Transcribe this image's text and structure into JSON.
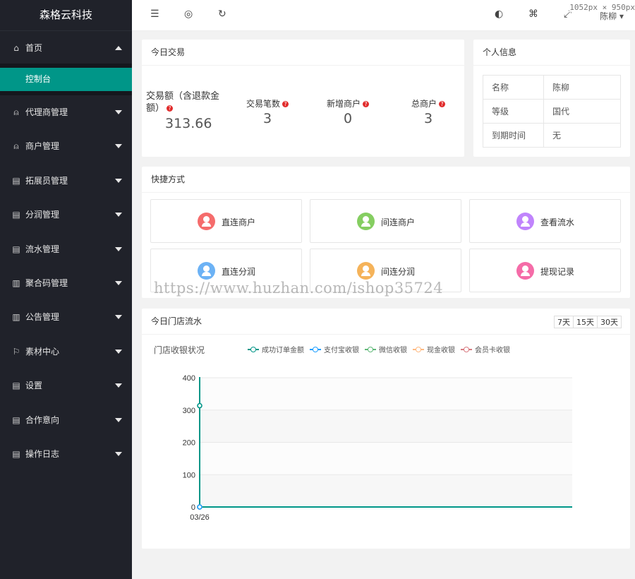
{
  "brand": "森格云科技",
  "sidebar": {
    "home": "首页",
    "active_sub": "控制台",
    "items": [
      {
        "label": "代理商管理",
        "icon": "user-icon"
      },
      {
        "label": "商户管理",
        "icon": "user-icon"
      },
      {
        "label": "拓展员管理",
        "icon": "document-icon"
      },
      {
        "label": "分润管理",
        "icon": "document-icon"
      },
      {
        "label": "流水管理",
        "icon": "document-icon"
      },
      {
        "label": "聚合码管理",
        "icon": "table-icon"
      },
      {
        "label": "公告管理",
        "icon": "table-icon"
      },
      {
        "label": "素材中心",
        "icon": "flag-icon"
      },
      {
        "label": "设置",
        "icon": "document-icon"
      },
      {
        "label": "合作意向",
        "icon": "document-icon"
      },
      {
        "label": "操作日志",
        "icon": "document-icon"
      }
    ]
  },
  "header": {
    "user": "陈柳",
    "size_badge": "1052px × 950px",
    "icons": [
      "menu-fold-icon",
      "globe-icon",
      "refresh-icon",
      "theme-icon",
      "tag-icon",
      "fullscreen-icon"
    ]
  },
  "today_trade": {
    "title": "今日交易",
    "stats": [
      {
        "label": "交易额（含退款金额）",
        "value": "313.66"
      },
      {
        "label": "交易笔数",
        "value": "3"
      },
      {
        "label": "新增商户",
        "value": "0"
      },
      {
        "label": "总商户",
        "value": "3"
      }
    ]
  },
  "personal": {
    "title": "个人信息",
    "rows": [
      {
        "k": "名称",
        "v": "陈柳"
      },
      {
        "k": "等级",
        "v": "国代"
      },
      {
        "k": "到期时间",
        "v": "无"
      }
    ]
  },
  "shortcuts": {
    "title": "快捷方式",
    "items": [
      {
        "label": "直连商户",
        "color": "#f56c6c"
      },
      {
        "label": "间连商户",
        "color": "#85ce61"
      },
      {
        "label": "查看流水",
        "color": "#c084fc"
      },
      {
        "label": "直连分润",
        "color": "#6cb2f5"
      },
      {
        "label": "间连分润",
        "color": "#f5b35a"
      },
      {
        "label": "提现记录",
        "color": "#f56ca8"
      }
    ]
  },
  "watermark": "https://www.huzhan.com/ishop35724",
  "flow": {
    "title": "今日门店流水",
    "ranges": [
      "7天",
      "15天",
      "30天"
    ],
    "subtitle": "门店收银状况"
  },
  "chart_data": {
    "type": "line",
    "categories": [
      "03/26"
    ],
    "ylim": [
      0,
      400
    ],
    "yticks": [
      0,
      100,
      200,
      300,
      400
    ],
    "series": [
      {
        "name": "成功订单金额",
        "color": "#009688",
        "values": [
          313.66
        ]
      },
      {
        "name": "支付宝收银",
        "color": "#1e9fff",
        "values": [
          0
        ]
      },
      {
        "name": "微信收银",
        "color": "#5fb878",
        "values": [
          0
        ]
      },
      {
        "name": "现金收银",
        "color": "#ffb980",
        "values": [
          0
        ]
      },
      {
        "name": "会员卡收银",
        "color": "#d87a80",
        "values": [
          0
        ]
      }
    ]
  }
}
